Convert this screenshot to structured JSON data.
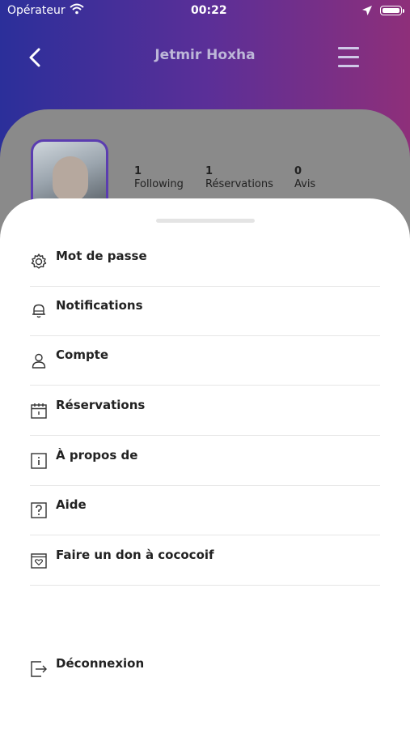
{
  "status_bar": {
    "carrier": "Opérateur",
    "time": "00:22"
  },
  "nav": {
    "title": "Jetmir Hoxha",
    "back_icon": "‹"
  },
  "profile": {
    "stats": [
      {
        "value": "1",
        "label": "Following"
      },
      {
        "value": "1",
        "label": "Réservations"
      },
      {
        "value": "0",
        "label": "Avis"
      }
    ]
  },
  "menu": {
    "items": [
      {
        "label": "Mot de passe",
        "icon": "gear-icon"
      },
      {
        "label": "Notifications",
        "icon": "bell-icon"
      },
      {
        "label": "Compte",
        "icon": "user-icon"
      },
      {
        "label": "Réservations",
        "icon": "calendar-icon"
      },
      {
        "label": "À propos de",
        "icon": "info-icon"
      },
      {
        "label": "Aide",
        "icon": "help-icon"
      },
      {
        "label": "Faire un don à cococoif",
        "icon": "donate-icon"
      }
    ],
    "logout": {
      "label": "Déconnexion",
      "icon": "logout-icon"
    }
  },
  "colors": {
    "gradient_start": "#2b2f9a",
    "gradient_end": "#8e2f7a",
    "accent": "#5b3db0",
    "text": "#222222"
  }
}
